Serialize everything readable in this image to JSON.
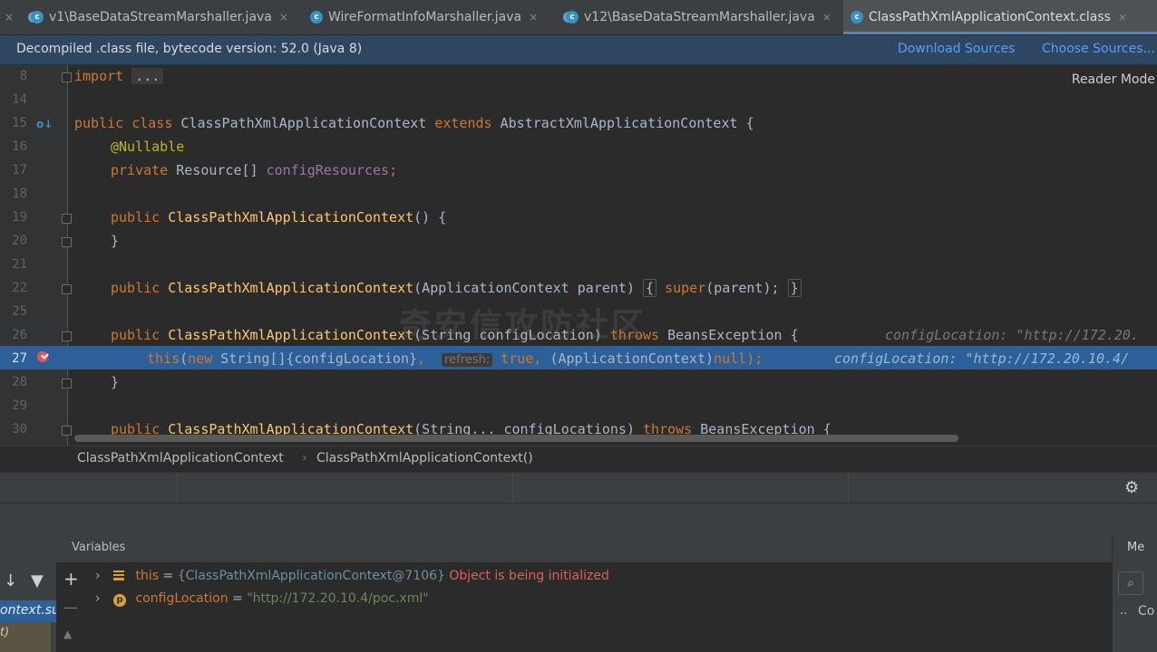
{
  "tabs": [
    {
      "label": "v1\\BaseDataStreamMarshaller.java",
      "icon": "class-icon"
    },
    {
      "label": "WireFormatInfoMarshaller.java",
      "icon": "class-icon"
    },
    {
      "label": "v12\\BaseDataStreamMarshaller.java",
      "icon": "class-icon"
    },
    {
      "label": "ClassPathXmlApplicationContext.class",
      "icon": "class-icon",
      "active": true
    }
  ],
  "tab_close": "×",
  "banner": {
    "text": "Decompiled .class file, bytecode version: 52.0 (Java 8)",
    "download": "Download Sources",
    "choose": "Choose Sources..."
  },
  "reader_mode": "Reader Mode",
  "code": {
    "line_numbers": [
      "8",
      "14",
      "15",
      "16",
      "17",
      "18",
      "19",
      "20",
      "21",
      "22",
      "25",
      "26",
      "27",
      "28",
      "29",
      "30"
    ],
    "l8_import": "import",
    "l8_dots": "...",
    "l15": {
      "k1": "public",
      "k2": "class",
      "name": "ClassPathXmlApplicationContext",
      "k3": "extends",
      "parent": "AbstractXmlApplicationContext",
      "brace": "{"
    },
    "l16": "@Nullable",
    "l17": {
      "k": "private",
      "type": "Resource[]",
      "field": "configResources",
      "semi": ";"
    },
    "l19": {
      "k": "public",
      "fn": "ClassPathXmlApplicationContext",
      "rest": "() {"
    },
    "l20": "}",
    "l22": {
      "k": "public",
      "fn": "ClassPathXmlApplicationContext",
      "args": "(ApplicationContext parent)",
      "ob": "{",
      "sup": "super",
      "supargs": "(parent);",
      "cb": "}"
    },
    "l26": {
      "k": "public",
      "fn": "ClassPathXmlApplicationContext",
      "args": "(String configLocation)",
      "thr": "throws",
      "exc": "BeansException {",
      "hint": "configLocation: \"http://172.20."
    },
    "l27": {
      "this": "this",
      "p1": "(",
      "new": "new",
      "arr": "String[]{configLocation}",
      "comma": ",",
      "hint": "refresh:",
      "tru": "true",
      "comma2": ",",
      "cast": "(ApplicationContext)",
      "nul": "null",
      "end": ");",
      "inline": "configLocation: \"http://172.20.10.4/"
    },
    "l28": "}",
    "l30": {
      "k": "public",
      "fn": "ClassPathXmlApplicationContext",
      "args": "(String... configLocations)",
      "thr": "throws",
      "exc": "BeansException {"
    }
  },
  "watermark": "奇安信攻防社区",
  "breadcrumbs": [
    "ClassPathXmlApplicationContext",
    "ClassPathXmlApplicationContext()"
  ],
  "breadcrumb_sep": "›",
  "debug": {
    "variables_title": "Variables",
    "right_title": "Me",
    "frame_item": "ontext.su",
    "frame_sub": "t)",
    "right_row": "Co",
    "right_dots": "..",
    "vars": [
      {
        "name": "this",
        "eq": " = ",
        "value": "{ClassPathXmlApplicationContext@7106}",
        "note": " Object is being initialized",
        "icon": "field-list-icon"
      },
      {
        "name": "configLocation",
        "eq": " = ",
        "value": "\"http://172.20.10.4/poc.xml\"",
        "icon": "parameter-icon"
      }
    ]
  },
  "colors": {
    "accent": "#4a88c7",
    "highlight": "#2d6099",
    "keyword": "#cc7832",
    "function": "#ffc66d",
    "annotation": "#bbb529",
    "field": "#9876aa",
    "string": "#6a8759",
    "error": "#e35d5d"
  }
}
